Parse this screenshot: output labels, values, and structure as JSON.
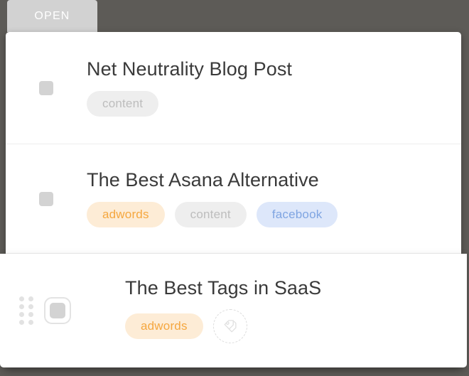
{
  "window": {
    "background_color": "#5d5b57",
    "card_background": "#ffffff"
  },
  "tab": {
    "label": "OPEN",
    "background_color": "#d2d2d2",
    "text_color": "#ffffff"
  },
  "colors": {
    "tag_gray_bg": "#eeeeee",
    "tag_gray_text": "#bdbdbd",
    "tag_orange_bg": "#fdecd6",
    "tag_orange_text": "#f5a73f",
    "tag_blue_bg": "#dde7fa",
    "tag_blue_text": "#7fa5e2",
    "title_text": "#3a3a3a",
    "checkbox": "#d3d3d3",
    "divider": "#ededed"
  },
  "list": {
    "items": [
      {
        "title": "Net Neutrality Blog Post",
        "checkbox_checked": false,
        "dragging": false,
        "has_drag_handle": false,
        "has_add_tag": false,
        "tags": [
          {
            "label": "content",
            "color": "gray"
          }
        ]
      },
      {
        "title": "The Best Asana Alternative",
        "checkbox_checked": false,
        "dragging": false,
        "has_drag_handle": false,
        "has_add_tag": false,
        "tags": [
          {
            "label": "adwords",
            "color": "orange"
          },
          {
            "label": "content",
            "color": "gray"
          },
          {
            "label": "facebook",
            "color": "blue"
          }
        ]
      },
      {
        "title": "The Best Tags in SaaS",
        "checkbox_checked": false,
        "dragging": true,
        "has_drag_handle": true,
        "has_add_tag": true,
        "tags": [
          {
            "label": "adwords",
            "color": "orange"
          }
        ]
      }
    ]
  },
  "icons": {
    "drag_handle": "drag-handle-icon",
    "add_tag": "add-tag-icon"
  }
}
